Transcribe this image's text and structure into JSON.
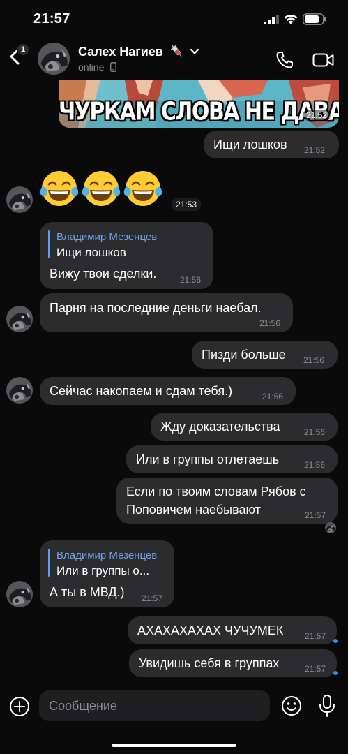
{
  "status_bar": {
    "time": "21:57"
  },
  "header": {
    "back_badge": "1",
    "contact_name": "Салех Нагиев",
    "name_emoji": "syringe-emoji",
    "status": "online"
  },
  "meme": {
    "caption": "ЧУРКАМ СЛОВА НЕ ДАВАЛИ",
    "time": "21:52"
  },
  "messages": [
    {
      "text": "Ищи лошков",
      "time": "21:52",
      "side": "out"
    },
    {
      "emoji": [
        "😂",
        "😂",
        "😂"
      ],
      "time": "21:53",
      "side": "in"
    },
    {
      "quote_author": "Владимир Мезенцев",
      "quote_text": "Ищи лошков",
      "text": "Вижу твои сделки.",
      "time": "21:56",
      "side": "in"
    },
    {
      "text": "Парня на последние деньги наебал.",
      "time": "21:56",
      "side": "in"
    },
    {
      "text": "Пизди больше",
      "time": "21:56",
      "side": "out"
    },
    {
      "text": "Сейчас накопаем и сдам тебя.)",
      "time": "21:56",
      "side": "in"
    },
    {
      "text": "Жду доказательства",
      "time": "21:56",
      "side": "out"
    },
    {
      "text": "Или в группы отлетаешь",
      "time": "21:56",
      "side": "out"
    },
    {
      "lines": [
        "Если по твоим словам Рябов с",
        "Поповичем наебывают"
      ],
      "time": "21:57",
      "side": "out"
    },
    {
      "quote_author": "Владимир Мезенцев",
      "quote_text": "Или в группы о...",
      "text": "А ты в МВД.)",
      "time": "21:57",
      "side": "in"
    },
    {
      "text": "АХАХАХАХАХ ЧУЧУМЕК",
      "time": "21:57",
      "side": "out"
    },
    {
      "text": "Увидишь себя в группах",
      "time": "21:57",
      "side": "out"
    }
  ],
  "input": {
    "placeholder": "Сообщение"
  },
  "icons": {
    "attach": "plus-circle-icon",
    "sticker": "smiley-icon",
    "mic": "microphone-icon",
    "call": "phone-icon",
    "video": "video-camera-icon"
  },
  "colors": {
    "background": "#0a0a0a",
    "bubble": "#2c2c2e",
    "quote_accent": "#6ea4f0",
    "unread_dot": "#3e8af5"
  }
}
